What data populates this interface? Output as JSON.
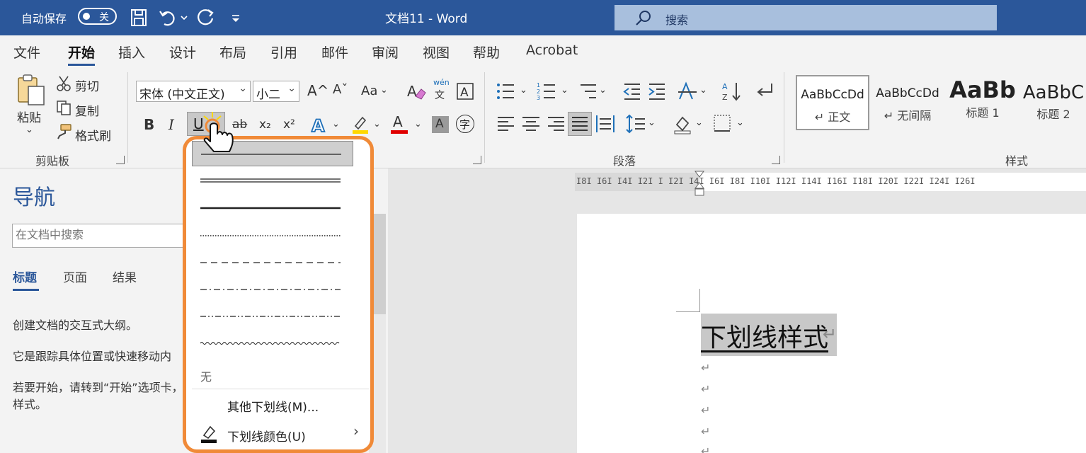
{
  "titlebar": {
    "autosave_label": "自动保存",
    "autosave_state": "关",
    "title": "文档11  -  Word",
    "search_label": "搜索"
  },
  "menu": {
    "tabs": [
      "文件",
      "开始",
      "插入",
      "设计",
      "布局",
      "引用",
      "邮件",
      "审阅",
      "视图",
      "帮助",
      "Acrobat"
    ],
    "active_tab": "开始"
  },
  "ribbon": {
    "clipboard": {
      "paste": "粘贴",
      "cut": "剪切",
      "copy": "复制",
      "format_painter": "格式刷",
      "group_label": "剪贴板"
    },
    "font": {
      "font_name": "宋体 (中文正文)",
      "font_size": "小二",
      "case_label": "Aa",
      "phonetic_top": "wén",
      "phonetic_bottom": "文",
      "bold": "B",
      "italic": "I",
      "underline": "U",
      "strike": "ab",
      "subscript": "x₂",
      "superscript": "x²",
      "grow": "A^",
      "shrink": "Aˇ",
      "font_color_label": "A",
      "shade_label": "A",
      "enclose_label": "字"
    },
    "paragraph": {
      "group_label": "段落"
    },
    "styles": {
      "group_label": "样式",
      "tiles": [
        {
          "sample": "AaBbCcDd",
          "name": "↵ 正文"
        },
        {
          "sample": "AaBbCcDd",
          "name": "↵ 无间隔"
        },
        {
          "sample": "AaBb",
          "name": "标题 1"
        },
        {
          "sample": "AaBbC",
          "name": "标题 2"
        }
      ]
    }
  },
  "nav": {
    "title": "导航",
    "search_placeholder": "在文档中搜索",
    "tabs": [
      "标题",
      "页面",
      "结果"
    ],
    "text1": "创建文档的交互式大纲。",
    "text2": "它是跟踪具体位置或快速移动内",
    "text3": "若要开始，请转到“开始”选项卡，",
    "text4": "样式。"
  },
  "ruler": {
    "ticks": "I8I  I6I  I4I  I2I   I    I2I  I4I  I6I  I8I  I10I  I12I  I14I  I16I  I18I  I20I  I22I  I24I  I26I"
  },
  "document": {
    "text": "下划线样式",
    "return_mark": "↵"
  },
  "underline_menu": {
    "none_label": "无",
    "more_label": "其他下划线(M)...",
    "color_label": "下划线颜色(U)",
    "arrow": "›"
  },
  "colors": {
    "title_bar": "#2b579a",
    "callout": "#f08a38",
    "font_color_bar": "#e00000",
    "highlight_bar": "#ffd800"
  }
}
